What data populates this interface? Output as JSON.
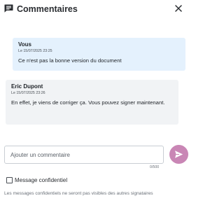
{
  "header": {
    "title": "Commentaires",
    "icon": "comment-icon",
    "close_icon": "close-icon"
  },
  "messages": [
    {
      "author": "Vous",
      "date": "Le 15/07/2025 23:25",
      "text": "Ce n'est pas la bonne version du document",
      "background": "#e4f1fd"
    },
    {
      "author": "Eric Dupont",
      "date": "Le 15/07/2025 23:26",
      "text": "En effet, je viens de corriger ça. Vous pouvez signer maintenant.",
      "background": "#f1f3f5"
    }
  ],
  "composer": {
    "placeholder": "Ajouter un commentaire",
    "value": "",
    "counter": "0/500",
    "send_icon": "send-icon",
    "send_color": "#c986b5"
  },
  "confidential": {
    "label": "Message confidentiel",
    "checked": false,
    "note": "Les messages confidentiels ne seront pas visibles des autres signataires"
  }
}
